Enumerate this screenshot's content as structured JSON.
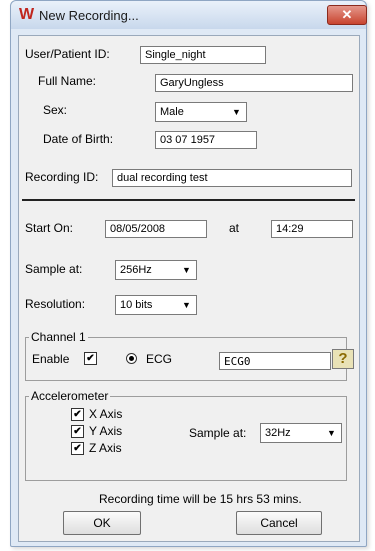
{
  "window": {
    "title": "New Recording...",
    "logo": "W",
    "close_glyph": "✕"
  },
  "patient": {
    "user_id_label": "User/Patient ID:",
    "user_id_value": "Single_night",
    "full_name_label": "Full Name:",
    "full_name_value": "GaryUngless",
    "sex_label": "Sex:",
    "sex_value": "Male",
    "dob_label": "Date of Birth:",
    "dob_value": "03 07 1957"
  },
  "recording": {
    "id_label": "Recording ID:",
    "id_value": "dual recording test"
  },
  "schedule": {
    "start_label": "Start On:",
    "start_date": "08/05/2008",
    "at_label": "at",
    "start_time": "14:29",
    "sample_label": "Sample at:",
    "sample_value": "256Hz",
    "resolution_label": "Resolution:",
    "resolution_value": "10 bits"
  },
  "channel1": {
    "title": "Channel 1",
    "enable_label": "Enable",
    "ecg_label": "ECG",
    "channel_name": "ECG0",
    "help_glyph": "?"
  },
  "accelerometer": {
    "title": "Accelerometer",
    "x_label": "X Axis",
    "y_label": "Y Axis",
    "z_label": "Z Axis",
    "sample_label": "Sample at:",
    "sample_value": "32Hz"
  },
  "status": {
    "recording_time": "Recording time will be 15 hrs 53 mins."
  },
  "buttons": {
    "ok": "OK",
    "cancel": "Cancel"
  },
  "glyphs": {
    "check": "✔",
    "dropdown": "▼"
  }
}
